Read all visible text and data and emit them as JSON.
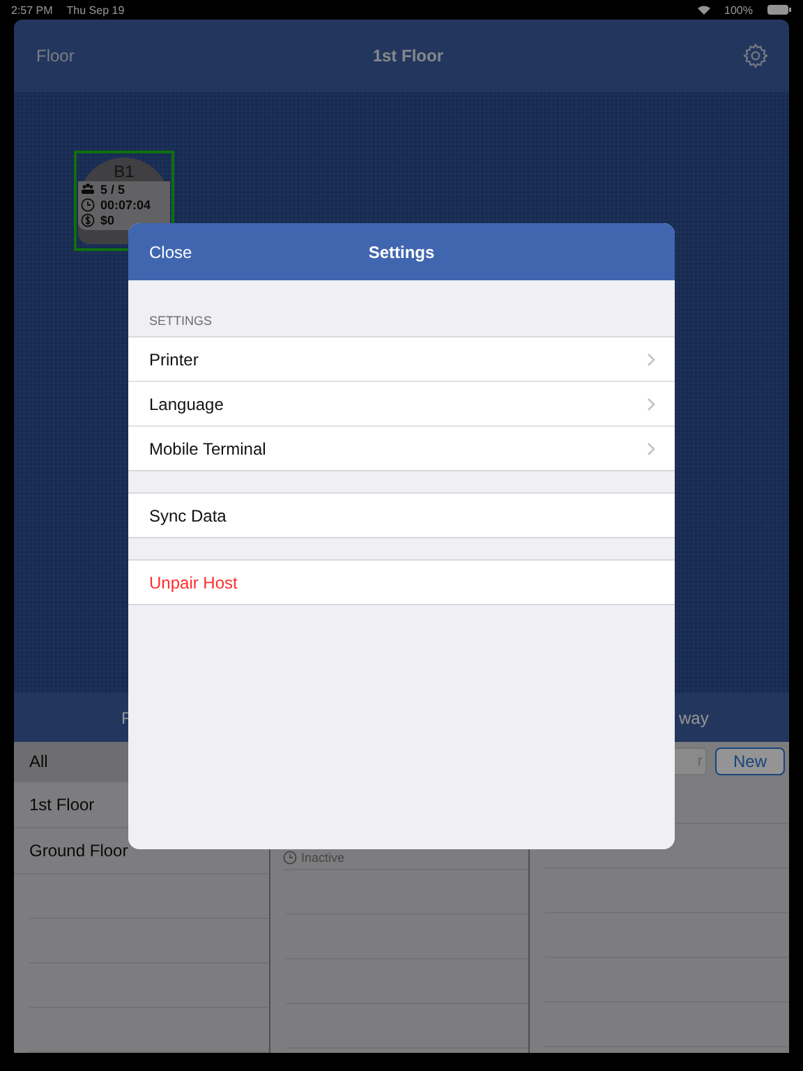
{
  "status_bar": {
    "time": "2:57 PM",
    "date": "Thu Sep 19",
    "battery": "100%"
  },
  "header": {
    "left": "Floor",
    "title": "1st Floor"
  },
  "floor_tables": [
    {
      "name": "B1",
      "guests": "5 / 5",
      "time": "00:07:04",
      "amount": "$0",
      "selected": true
    }
  ],
  "bottom_panel": {
    "header_left": "F",
    "header_right": "way",
    "floors": [
      {
        "label": "All",
        "selected": true
      },
      {
        "label": "1st Floor",
        "selected": false
      },
      {
        "label": "Ground Floor",
        "selected": false
      }
    ],
    "middle_status": "Inactive",
    "search": {
      "placeholder": "r"
    },
    "new_button": "New"
  },
  "modal": {
    "close": "Close",
    "title": "Settings",
    "section": "SETTINGS",
    "groups": [
      [
        {
          "label": "Printer",
          "kind": "link"
        },
        {
          "label": "Language",
          "kind": "link"
        },
        {
          "label": "Mobile Terminal",
          "kind": "link"
        }
      ],
      [
        {
          "label": "Sync Data",
          "kind": "action"
        }
      ],
      [
        {
          "label": "Unpair Host",
          "kind": "danger"
        }
      ]
    ]
  }
}
